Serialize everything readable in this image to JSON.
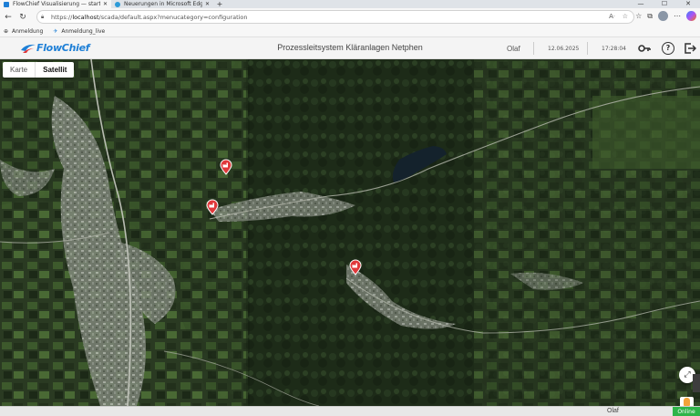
{
  "browser": {
    "tabs": [
      {
        "title": "FlowChief Visualisierung — startseite",
        "active": true
      },
      {
        "title": "Neuerungen in Microsoft Edge",
        "active": false
      }
    ],
    "new_tab": "+",
    "window_controls": {
      "minimize": "—",
      "maximize": "☐",
      "close": "✕"
    },
    "url_prefix": "https://",
    "url_host": "localhost",
    "url_path": "/scada/default.aspx?menucategory=configuration",
    "favorites": [
      {
        "label": "Anmeldung",
        "icon": "globe-icon"
      },
      {
        "label": "Anmeldung_live",
        "icon": "flowchief-icon"
      }
    ]
  },
  "app": {
    "logo_text": "FlowChief",
    "title": "Prozessleitsystem Kläranlagen Netphen",
    "user": "Olaf",
    "date": "12.06.2025",
    "time": "17:28:04",
    "icons": {
      "key": "key-icon",
      "help": "help-icon",
      "logout": "logout-icon"
    },
    "help_glyph": "?",
    "colors": {
      "brand": "#1e7fd6",
      "marker": "#e0393b",
      "online": "#2fb44a"
    }
  },
  "map": {
    "view_options": [
      "Karte",
      "Satellit"
    ],
    "selected_view": "Satellit",
    "markers": [
      {
        "name": "plant-marker-1",
        "icon": "factory-icon"
      },
      {
        "name": "plant-marker-2",
        "icon": "factory-icon"
      },
      {
        "name": "plant-marker-3",
        "icon": "factory-icon"
      }
    ],
    "fullscreen_icon": "fullscreen-icon",
    "pegman_icon": "pegman-icon"
  },
  "statusbar": {
    "user": "Olaf",
    "status": "Online"
  }
}
